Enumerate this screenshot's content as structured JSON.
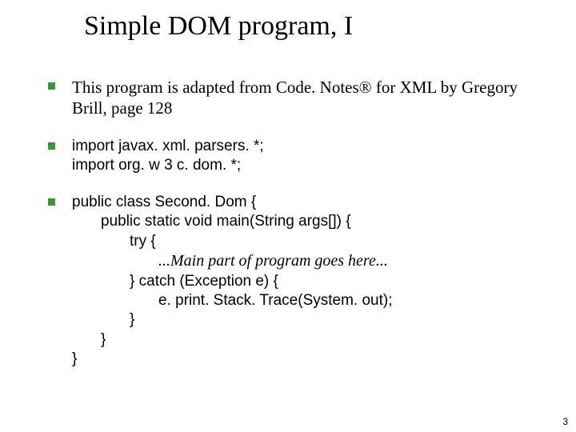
{
  "title": "Simple DOM program, I",
  "items": {
    "intro": "This program is adapted from Code. Notes® for XML by Gregory Brill, page 128",
    "imports_l1": "import javax. xml. parsers. *;",
    "imports_l2": "import org. w 3 c. dom. *;",
    "code": {
      "l1": "public class Second. Dom {",
      "l2": "public static void main(String args[]) {",
      "l3": "try {",
      "l4": "...Main part of program goes here...",
      "l5": "} catch (Exception e) {",
      "l6": "e. print. Stack. Trace(System. out);",
      "l7": "}",
      "l8": "}",
      "l9": "}"
    }
  },
  "page_number": "3"
}
